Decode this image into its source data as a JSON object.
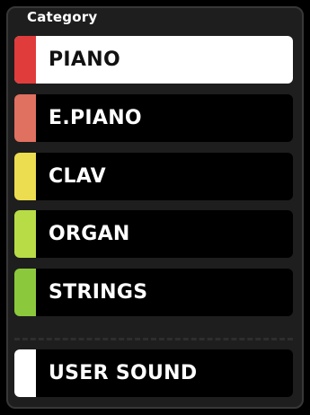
{
  "panel": {
    "title": "Category"
  },
  "categories": [
    {
      "label": "PIANO",
      "color": "#e03c3c",
      "selected": true
    },
    {
      "label": "E.PIANO",
      "color": "#e07060",
      "selected": false
    },
    {
      "label": "CLAV",
      "color": "#ecdc50",
      "selected": false
    },
    {
      "label": "ORGAN",
      "color": "#b8dc46",
      "selected": false
    },
    {
      "label": "STRINGS",
      "color": "#8cc83c",
      "selected": false
    }
  ],
  "user_sound": {
    "label": "USER SOUND",
    "color": "#ffffff",
    "selected": false
  },
  "colors": {
    "panel_bg": "#1e1e1e",
    "button_bg": "#000000",
    "selected_bg": "#ffffff"
  }
}
